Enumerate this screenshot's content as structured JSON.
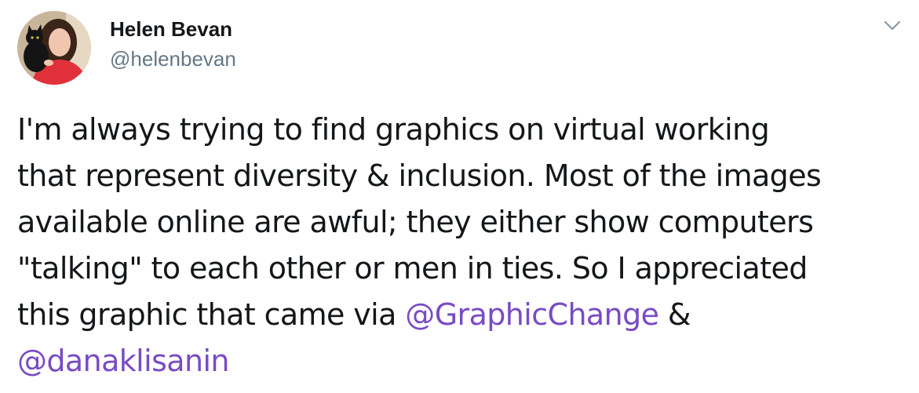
{
  "author": {
    "display_name": "Helen Bevan",
    "handle": "@helenbevan",
    "avatar_icon": "profile-photo-with-black-cat"
  },
  "menu": {
    "icon": "chevron-down-icon"
  },
  "tweet": {
    "line_1": "I'm always trying to find graphics on virtual working",
    "line_2": "that represent diversity & inclusion. Most of the images",
    "line_3": "available online are awful; they either show computers",
    "line_4": "\"talking\" to each other or men in ties. So I appreciated",
    "line_5_text": "this graphic that came via ",
    "mention_1": "@GraphicChange",
    "line_5_tail": " &",
    "mention_2": "@danaklisanin"
  },
  "colors": {
    "text": "#14171a",
    "secondary": "#657786",
    "mention": "#794bc4"
  }
}
